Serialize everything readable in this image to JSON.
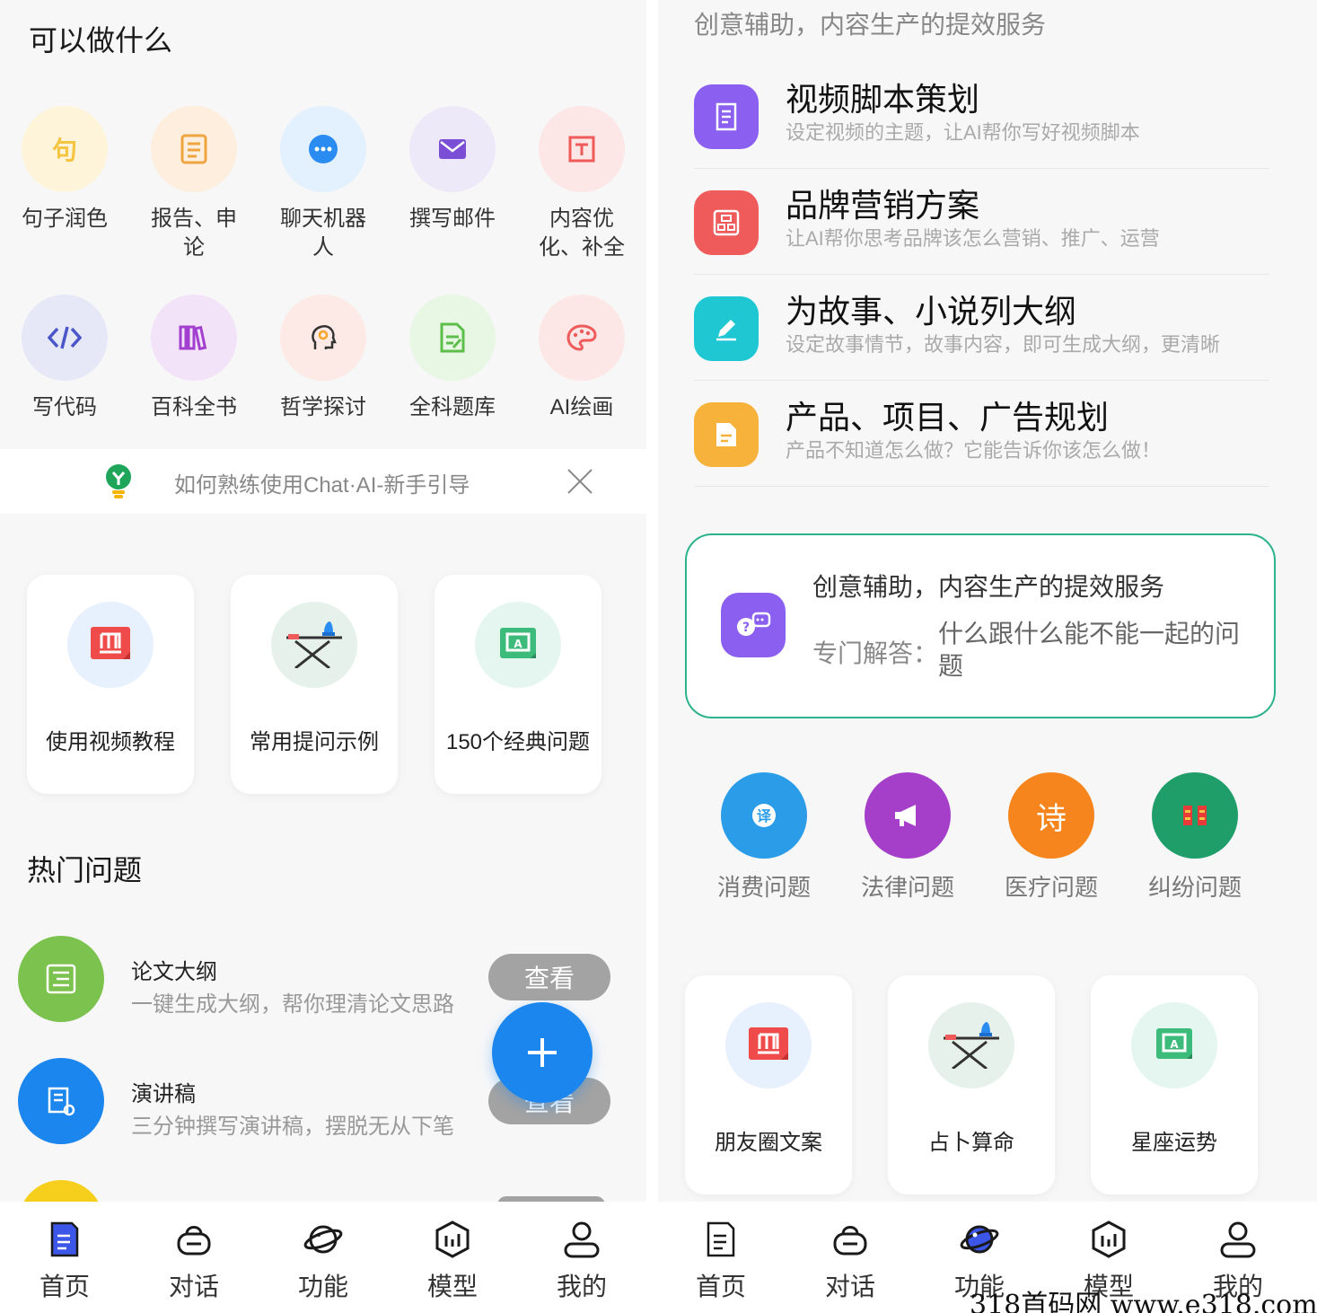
{
  "left": {
    "section_title": "可以做什么",
    "features": [
      {
        "label": "句子润色",
        "icon": "sentence-icon",
        "color": "#f5c542",
        "bg": "#fdf4d9"
      },
      {
        "label": "报告、申论",
        "icon": "report-icon",
        "color": "#f0a440",
        "bg": "#fdeede"
      },
      {
        "label": "聊天机器人",
        "icon": "chatbot-icon",
        "color": "#2a8cf0",
        "bg": "#e3f0fd"
      },
      {
        "label": "撰写邮件",
        "icon": "mail-icon",
        "color": "#7a4fd6",
        "bg": "#eee9f8"
      },
      {
        "label": "内容优化、补全",
        "icon": "content-icon",
        "color": "#ef5a5a",
        "bg": "#fde6e6"
      },
      {
        "label": "写代码",
        "icon": "code-icon",
        "color": "#4a55c8",
        "bg": "#e6e8f7"
      },
      {
        "label": "百科全书",
        "icon": "encyclopedia-icon",
        "color": "#a23fd0",
        "bg": "#f3e3f8"
      },
      {
        "label": "哲学探讨",
        "icon": "philosophy-icon",
        "color": "#333333",
        "bg": "#fde9e6"
      },
      {
        "label": "全科题库",
        "icon": "question-bank-icon",
        "color": "#5cbf4a",
        "bg": "#e8f6e4"
      },
      {
        "label": "AI绘画",
        "icon": "palette-icon",
        "color": "#ef5a5a",
        "bg": "#fde6e6"
      }
    ],
    "guide_text": "如何熟练使用Chat·AI-新手引导",
    "cards": [
      {
        "label": "使用视频教程",
        "bg": "#e7f0fd"
      },
      {
        "label": "常用提问示例",
        "bg": "#e7f1ec"
      },
      {
        "label": "150个经典问题",
        "bg": "#e4f6ef"
      }
    ],
    "hot_title": "热门问题",
    "hot_items": [
      {
        "title": "论文大纲",
        "subtitle": "一键生成大纲，帮你理清论文思路",
        "button": "查看",
        "color": "#7cc24f"
      },
      {
        "title": "演讲稿",
        "subtitle": "三分钟撰写演讲稿，摆脱无从下笔",
        "button": "查看",
        "color": "#1b86ee"
      }
    ]
  },
  "right": {
    "header": "创意辅助，内容生产的提效服务",
    "services": [
      {
        "title": "视频脚本策划",
        "subtitle": "设定视频的主题，让AI帮你写好视频脚本",
        "color": "#8b5ff0"
      },
      {
        "title": "品牌营销方案",
        "subtitle": "让AI帮你思考品牌该怎么营销、推广、运营",
        "color": "#ef5a5a"
      },
      {
        "title": "为故事、小说列大纲",
        "subtitle": "设定故事情节，故事内容，即可生成大纲，更清晰",
        "color": "#1fc7d2"
      },
      {
        "title": "产品、项目、广告规划",
        "subtitle": "产品不知道怎么做？它能告诉你该怎么做！",
        "color": "#f7b23b"
      }
    ],
    "qa_box": {
      "title": "创意辅助，内容生产的提效服务",
      "label": "专门解答：",
      "text": "什么跟什么能不能一起的问题"
    },
    "categories": [
      {
        "label": "消费问题",
        "glyph": "译",
        "color": "#2a9ce8"
      },
      {
        "label": "法律问题",
        "glyph": "",
        "color": "#a53fc9"
      },
      {
        "label": "医疗问题",
        "glyph": "诗",
        "color": "#f5851c"
      },
      {
        "label": "纠纷问题",
        "glyph": "",
        "color": "#1f9e6a"
      }
    ],
    "cards": [
      {
        "label": "朋友圈文案",
        "bg": "#e7f0fd"
      },
      {
        "label": "占卜算命",
        "bg": "#e7f1ec"
      },
      {
        "label": "星座运势",
        "bg": "#e4f6ef"
      }
    ]
  },
  "tabs": [
    "首页",
    "对话",
    "功能",
    "模型",
    "我的"
  ],
  "watermark": "318首码网  www.e318.com"
}
